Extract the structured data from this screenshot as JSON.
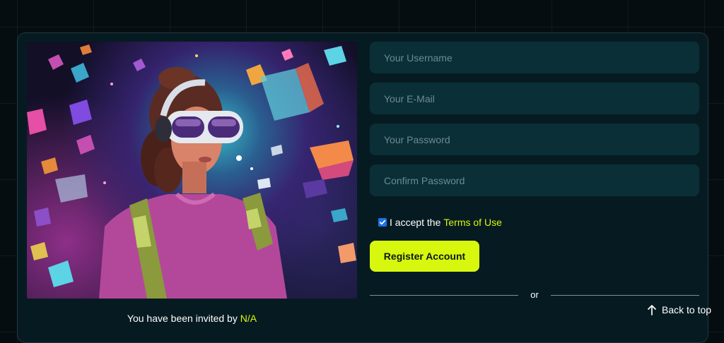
{
  "form": {
    "username_placeholder": "Your Username",
    "email_placeholder": "Your E-Mail",
    "password_placeholder": "Your Password",
    "confirm_placeholder": "Confirm Password",
    "terms_prefix": "I accept the",
    "terms_link": "Terms of Use",
    "terms_checked": true,
    "register_label": "Register Account",
    "divider_text": "or"
  },
  "invite": {
    "prefix": "You have been invited by",
    "inviter": "N/A"
  },
  "footer": {
    "back_to_top": "Back to top",
    "back_icon": "arrow-up-icon"
  },
  "colors": {
    "accent": "#d7f70f",
    "card_bg": "#061b21",
    "field_bg": "#0a2f37",
    "page_bg": "#050d11"
  }
}
